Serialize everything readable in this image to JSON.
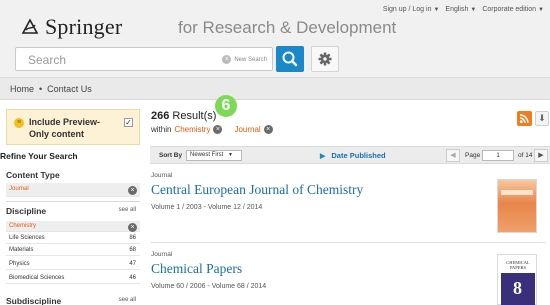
{
  "header": {
    "logo_text": "Springer",
    "tagline": "for Research & Development",
    "top_links": [
      "Sign up / Log in",
      "English",
      "Corporate edition"
    ],
    "search_placeholder": "Search",
    "new_search_label": "New Search"
  },
  "breadcrumb": [
    "Home",
    "Contact Us"
  ],
  "sidebar": {
    "preview_label": "Include Preview-Only content",
    "preview_checked": true,
    "refine_title": "Refine Your Search",
    "content_type": {
      "title": "Content Type",
      "items": [
        {
          "label": "Journal",
          "active": true
        }
      ]
    },
    "discipline": {
      "title": "Discipline",
      "see_all": "see all",
      "items": [
        {
          "label": "Chemistry",
          "count": "",
          "active": true
        },
        {
          "label": "Life Sciences",
          "count": "86"
        },
        {
          "label": "Materials",
          "count": "68"
        },
        {
          "label": "Physics",
          "count": "47"
        },
        {
          "label": "Biomedical Sciences",
          "count": "46"
        }
      ]
    },
    "subdiscipline": {
      "title": "Subdiscipline",
      "see_all": "see all"
    }
  },
  "results": {
    "count": "266",
    "count_suffix": " Result(s)",
    "within_label": "within",
    "filters": [
      "Chemistry",
      "Journal"
    ],
    "step_badge": "6"
  },
  "sortbar": {
    "sort_by_label": "Sort By",
    "sort_value": "Newest First",
    "date_published_label": "Date Published",
    "page_label": "Page",
    "page_value": "1",
    "page_of": "of 14"
  },
  "items": [
    {
      "type": "Journal",
      "title": "Central European Journal of Chemistry",
      "volume": "Volume 1 / 2003 - Volume 12 / 2014"
    },
    {
      "type": "Journal",
      "title": "Chemical Papers",
      "volume": "Volume 60 / 2006 - Volume 68 / 2014",
      "cover_title": "CHEMICAL PAPERS",
      "cover_number": "8"
    }
  ],
  "colors": {
    "accent_blue": "#1a88c9",
    "link_blue": "#1a6fa8",
    "active_orange": "#e05b12",
    "rss_orange": "#ee7d1f",
    "badge_green": "#7ed957",
    "preview_bg": "#fdf1d6"
  },
  "icons": [
    "springer-logo-icon",
    "search-icon",
    "gear-icon",
    "rss-icon",
    "download-icon",
    "remove-filter-icon",
    "chevron-down-icon",
    "arrow-left-icon",
    "arrow-right-icon",
    "triangle-right-icon"
  ]
}
